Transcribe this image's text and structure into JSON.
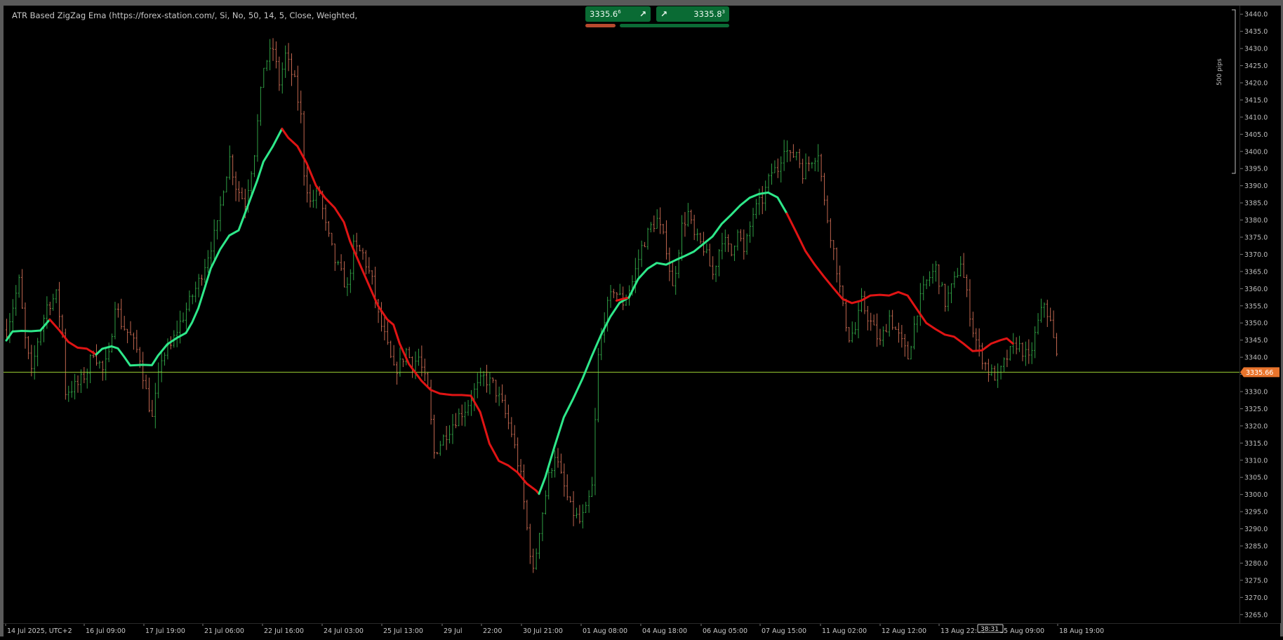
{
  "indicator": {
    "title": "ATR Based ZigZag Ema (https://forex-station.com/, Si, No, 50, 14, 5, Close, Weighted,"
  },
  "quick_trade": {
    "sell_price": "3335.6",
    "sell_superscript": "6",
    "buy_price": "3335.8",
    "buy_superscript": "3",
    "sell_arrow": "↗",
    "buy_arrow": "↗"
  },
  "pips_label": "500 pips",
  "current_price_label": "3335.66",
  "countdown": "38:31",
  "colors": {
    "background": "#000000",
    "bull_candle": "#2f9e44",
    "bear_candle": "#c0664f",
    "ema_up": "#2ee88a",
    "ema_down": "#e01414",
    "price_line": "#9acd32",
    "price_tag": "#e8742c",
    "quick_trade": "#0a6b34"
  },
  "chart_data": {
    "type": "candlestick-line",
    "symbol_price_axis": {
      "min": 3262.5,
      "max": 3442.5,
      "tick_step": 5,
      "ticks": [
        "3440.0",
        "3435.0",
        "3430.0",
        "3425.0",
        "3420.0",
        "3415.0",
        "3410.0",
        "3405.0",
        "3400.0",
        "3395.0",
        "3390.0",
        "3385.0",
        "3380.0",
        "3375.0",
        "3370.0",
        "3365.0",
        "3360.0",
        "3355.0",
        "3350.0",
        "3345.0",
        "3340.0",
        "3335.0",
        "3330.0",
        "3325.0",
        "3320.0",
        "3315.0",
        "3310.0",
        "3305.0",
        "3300.0",
        "3295.0",
        "3290.0",
        "3285.0",
        "3280.0",
        "3275.0",
        "3270.0",
        "3265.0"
      ]
    },
    "time_axis_labels": [
      "14 Jul 2025, UTC+2",
      "16 Jul 09:00",
      "17 Jul 19:00",
      "21 Jul 06:00",
      "22 Jul 16:00",
      "24 Jul 03:00",
      "25 Jul 13:00",
      "29 Jul",
      "22:00",
      "30 Jul 21:00",
      "01 Aug 08:00",
      "04 Aug 18:00",
      "06 Aug 05:00",
      "07 Aug 15:00",
      "11 Aug 02:00",
      "12 Aug 12:00",
      "13 Aug 22:00",
      "15 Aug 09:00",
      "18 Aug 19:00"
    ],
    "current_price": 3335.66,
    "close_path": [
      [
        0,
        3348
      ],
      [
        4,
        3362
      ],
      [
        6,
        3345
      ],
      [
        8,
        3335
      ],
      [
        10,
        3345
      ],
      [
        13,
        3355
      ],
      [
        16,
        3358
      ],
      [
        18,
        3347
      ],
      [
        19,
        3330
      ],
      [
        23,
        3332
      ],
      [
        26,
        3336
      ],
      [
        28,
        3342
      ],
      [
        31,
        3336
      ],
      [
        33,
        3340
      ],
      [
        35,
        3356
      ],
      [
        37,
        3350
      ],
      [
        40,
        3346
      ],
      [
        43,
        3340
      ],
      [
        45,
        3330
      ],
      [
        47,
        3322
      ],
      [
        50,
        3340
      ],
      [
        53,
        3343
      ],
      [
        55,
        3348
      ],
      [
        58,
        3354
      ],
      [
        62,
        3362
      ],
      [
        65,
        3370
      ],
      [
        68,
        3378
      ],
      [
        70,
        3390
      ],
      [
        72,
        3398
      ],
      [
        74,
        3390
      ],
      [
        77,
        3385
      ],
      [
        80,
        3400
      ],
      [
        83,
        3425
      ],
      [
        86,
        3430
      ],
      [
        88,
        3420
      ],
      [
        90,
        3428
      ],
      [
        93,
        3420
      ],
      [
        95,
        3410
      ],
      [
        96,
        3394
      ],
      [
        98,
        3385
      ],
      [
        101,
        3388
      ],
      [
        103,
        3378
      ],
      [
        106,
        3368
      ],
      [
        110,
        3360
      ],
      [
        112,
        3372
      ],
      [
        115,
        3370
      ],
      [
        118,
        3362
      ],
      [
        120,
        3352
      ],
      [
        122,
        3346
      ],
      [
        125,
        3336
      ],
      [
        127,
        3338
      ],
      [
        129,
        3342
      ],
      [
        131,
        3338
      ],
      [
        133,
        3340
      ],
      [
        136,
        3330
      ],
      [
        138,
        3312
      ],
      [
        142,
        3318
      ],
      [
        145,
        3322
      ],
      [
        148,
        3325
      ],
      [
        151,
        3330
      ],
      [
        154,
        3334
      ],
      [
        157,
        3332
      ],
      [
        160,
        3326
      ],
      [
        163,
        3318
      ],
      [
        166,
        3305
      ],
      [
        168,
        3290
      ],
      [
        170,
        3277
      ],
      [
        172,
        3290
      ],
      [
        175,
        3305
      ],
      [
        177,
        3312
      ],
      [
        179,
        3305
      ],
      [
        182,
        3296
      ],
      [
        185,
        3292
      ],
      [
        187,
        3295
      ],
      [
        189,
        3302
      ],
      [
        191,
        3340
      ],
      [
        193,
        3352
      ],
      [
        196,
        3360
      ],
      [
        199,
        3356
      ],
      [
        202,
        3362
      ],
      [
        205,
        3372
      ],
      [
        208,
        3378
      ],
      [
        210,
        3380
      ],
      [
        213,
        3372
      ],
      [
        215,
        3360
      ],
      [
        218,
        3378
      ],
      [
        220,
        3382
      ],
      [
        222,
        3375
      ],
      [
        225,
        3372
      ],
      [
        228,
        3364
      ],
      [
        231,
        3375
      ],
      [
        234,
        3370
      ],
      [
        236,
        3378
      ],
      [
        238,
        3370
      ],
      [
        241,
        3382
      ],
      [
        244,
        3386
      ],
      [
        247,
        3394
      ],
      [
        249,
        3395
      ],
      [
        251,
        3402
      ],
      [
        253,
        3398
      ],
      [
        255,
        3400
      ],
      [
        257,
        3394
      ],
      [
        260,
        3398
      ],
      [
        262,
        3400
      ],
      [
        264,
        3385
      ],
      [
        266,
        3376
      ],
      [
        268,
        3366
      ],
      [
        270,
        3354
      ],
      [
        272,
        3346
      ],
      [
        274,
        3348
      ],
      [
        276,
        3356
      ],
      [
        279,
        3350
      ],
      [
        282,
        3344
      ],
      [
        285,
        3352
      ],
      [
        288,
        3346
      ],
      [
        291,
        3340
      ],
      [
        294,
        3354
      ],
      [
        297,
        3362
      ],
      [
        300,
        3366
      ],
      [
        303,
        3356
      ],
      [
        306,
        3362
      ],
      [
        308,
        3368
      ],
      [
        310,
        3358
      ],
      [
        312,
        3348
      ],
      [
        314,
        3342
      ],
      [
        317,
        3336
      ],
      [
        320,
        3334
      ],
      [
        323,
        3340
      ],
      [
        326,
        3344
      ],
      [
        328,
        3342
      ],
      [
        330,
        3339
      ],
      [
        333,
        3350
      ],
      [
        335,
        3356
      ],
      [
        337,
        3350
      ],
      [
        339,
        3340
      ]
    ],
    "ema_segments": [
      {
        "trend": "up",
        "points": [
          [
            0,
            3344.9
          ],
          [
            2,
            3347.5
          ],
          [
            5,
            3347.7
          ],
          [
            8,
            3347.6
          ],
          [
            11,
            3347.8
          ],
          [
            14,
            3351
          ]
        ]
      },
      {
        "trend": "down",
        "points": [
          [
            14,
            3351
          ],
          [
            17,
            3348
          ],
          [
            20,
            3344.5
          ],
          [
            23,
            3342.8
          ],
          [
            26,
            3342.5
          ],
          [
            29,
            3340.8
          ]
        ]
      },
      {
        "trend": "up",
        "points": [
          [
            29,
            3340.8
          ],
          [
            31,
            3342.5
          ],
          [
            34,
            3343.2
          ],
          [
            36,
            3342.6
          ],
          [
            38,
            3340.2
          ],
          [
            40,
            3337.6
          ],
          [
            44,
            3337.8
          ],
          [
            47,
            3337.7
          ],
          [
            49,
            3340.5
          ],
          [
            52,
            3343.8
          ],
          [
            55,
            3345.6
          ],
          [
            58,
            3347.1
          ],
          [
            60,
            3350.2
          ],
          [
            62,
            3354.3
          ],
          [
            64,
            3360.0
          ],
          [
            66,
            3365.9
          ],
          [
            69,
            3371.4
          ],
          [
            72,
            3375.5
          ],
          [
            75,
            3377.0
          ],
          [
            78,
            3384.2
          ],
          [
            81,
            3391.5
          ],
          [
            83,
            3397.0
          ],
          [
            86,
            3401.4
          ],
          [
            89,
            3406.6
          ]
        ]
      },
      {
        "trend": "down",
        "points": [
          [
            89,
            3406.6
          ],
          [
            91,
            3404.0
          ],
          [
            94,
            3401.5
          ],
          [
            97,
            3396.5
          ],
          [
            100,
            3390.0
          ],
          [
            103,
            3386.4
          ],
          [
            106,
            3383.6
          ],
          [
            109,
            3379.4
          ],
          [
            111,
            3373.8
          ],
          [
            114,
            3367.4
          ],
          [
            117,
            3361.2
          ],
          [
            120,
            3355.0
          ],
          [
            123,
            3351.0
          ],
          [
            125,
            3349.5
          ],
          [
            127,
            3344.0
          ],
          [
            130,
            3338.0
          ],
          [
            134,
            3333.2
          ],
          [
            137,
            3330.5
          ],
          [
            140,
            3329.4
          ],
          [
            144,
            3329.0
          ],
          [
            147,
            3329.0
          ],
          [
            150,
            3328.8
          ],
          [
            153,
            3324.0
          ],
          [
            156,
            3314.8
          ],
          [
            159,
            3309.8
          ],
          [
            162,
            3308.5
          ],
          [
            165,
            3306.5
          ],
          [
            168,
            3303.2
          ],
          [
            171,
            3301.2
          ],
          [
            172,
            3300.2
          ]
        ]
      },
      {
        "trend": "up",
        "points": [
          [
            172,
            3300.2
          ],
          [
            174,
            3305.0
          ],
          [
            177,
            3314.0
          ],
          [
            180,
            3322.5
          ],
          [
            183,
            3327.9
          ],
          [
            186,
            3333.7
          ],
          [
            189,
            3340.3
          ],
          [
            192,
            3346.5
          ],
          [
            195,
            3351.8
          ],
          [
            198,
            3355.9
          ],
          [
            201,
            3357.4
          ]
        ]
      },
      {
        "trend": "down",
        "points": [
          [
            197,
            3356.5
          ],
          [
            199,
            3357.0
          ],
          [
            201,
            3357.4
          ]
        ]
      },
      {
        "trend": "up",
        "points": [
          [
            201,
            3357.4
          ],
          [
            204,
            3362.8
          ],
          [
            207,
            3365.8
          ],
          [
            210,
            3367.5
          ],
          [
            213,
            3367.0
          ],
          [
            216,
            3368.3
          ],
          [
            219,
            3369.5
          ],
          [
            222,
            3370.8
          ],
          [
            225,
            3373.0
          ],
          [
            228,
            3375.2
          ],
          [
            231,
            3378.9
          ],
          [
            234,
            3381.5
          ],
          [
            237,
            3384.3
          ],
          [
            240,
            3386.5
          ],
          [
            243,
            3387.6
          ],
          [
            246,
            3388.0
          ],
          [
            249,
            3386.6
          ],
          [
            252,
            3381.9
          ]
        ]
      },
      {
        "trend": "down",
        "points": [
          [
            252,
            3381.9
          ],
          [
            255,
            3376.5
          ],
          [
            258,
            3371.0
          ],
          [
            261,
            3367.0
          ],
          [
            264,
            3363.5
          ],
          [
            267,
            3360.2
          ],
          [
            270,
            3357.0
          ],
          [
            273,
            3355.8
          ],
          [
            276,
            3356.5
          ],
          [
            279,
            3358.0
          ],
          [
            282,
            3358.2
          ],
          [
            285,
            3358.0
          ],
          [
            288,
            3359.0
          ],
          [
            291,
            3358.0
          ],
          [
            294,
            3354.0
          ],
          [
            297,
            3350.0
          ],
          [
            300,
            3348.2
          ],
          [
            303,
            3346.6
          ],
          [
            306,
            3346.0
          ],
          [
            309,
            3344.0
          ],
          [
            312,
            3341.8
          ],
          [
            315,
            3342.0
          ],
          [
            318,
            3344.0
          ],
          [
            321,
            3345.0
          ],
          [
            323,
            3345.5
          ],
          [
            325,
            3344.0
          ]
        ]
      }
    ]
  }
}
